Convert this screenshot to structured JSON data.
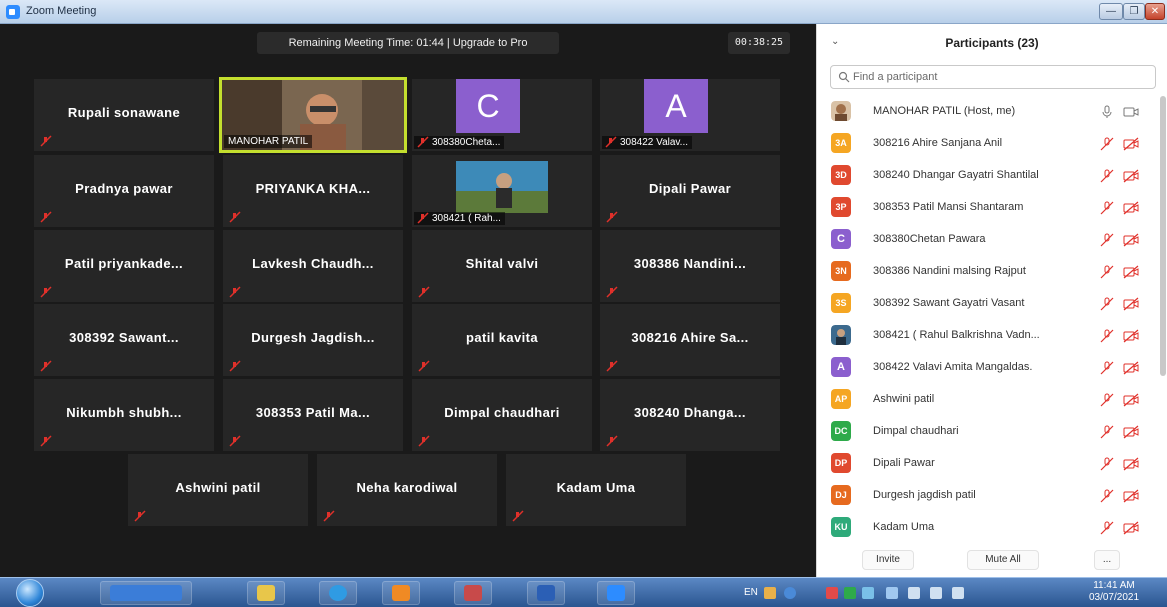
{
  "window": {
    "title": "Zoom Meeting"
  },
  "meeting": {
    "banner": "Remaining Meeting Time: 01:44 | Upgrade to Pro",
    "elapsed": "00:38:25",
    "tiles": [
      {
        "name": "Rupali sonawane"
      },
      {
        "name": "MANOHAR PATIL"
      },
      {
        "name": "308380Cheta...",
        "letter": "C"
      },
      {
        "name": "308422 Valav...",
        "letter": "A"
      },
      {
        "name": "Pradnya pawar"
      },
      {
        "name": "PRIYANKA KHA..."
      },
      {
        "name": "308421 ( Rah..."
      },
      {
        "name": "Dipali Pawar"
      },
      {
        "name": "Patil priyankade..."
      },
      {
        "name": "Lavkesh Chaudh..."
      },
      {
        "name": "Shital valvi"
      },
      {
        "name": "308386 Nandini..."
      },
      {
        "name": "308392 Sawant..."
      },
      {
        "name": "Durgesh Jagdish..."
      },
      {
        "name": "patil kavita"
      },
      {
        "name": "308216 Ahire Sa..."
      },
      {
        "name": "Nikumbh shubh..."
      },
      {
        "name": "308353 Patil Ma..."
      },
      {
        "name": "Dimpal chaudhari"
      },
      {
        "name": "308240 Dhanga..."
      },
      {
        "name": "Ashwini patil"
      },
      {
        "name": "Neha karodiwal"
      },
      {
        "name": "Kadam Uma"
      }
    ]
  },
  "participants": {
    "title": "Participants (23)",
    "search_placeholder": "Find a participant",
    "list": [
      {
        "name": "MANOHAR PATIL (Host, me)",
        "initials": "",
        "color": "#b07a4a"
      },
      {
        "name": "308216 Ahire Sanjana Anil",
        "initials": "3A",
        "color": "#f5a623"
      },
      {
        "name": "308240 Dhangar Gayatri Shantilal",
        "initials": "3D",
        "color": "#e0492f"
      },
      {
        "name": "308353 Patil Mansi Shantaram",
        "initials": "3P",
        "color": "#e0492f"
      },
      {
        "name": "308380Chetan Pawara",
        "initials": "C",
        "color": "#8b5fce"
      },
      {
        "name": "308386 Nandini malsing Rajput",
        "initials": "3N",
        "color": "#e66a1f"
      },
      {
        "name": "308392 Sawant Gayatri Vasant",
        "initials": "3S",
        "color": "#f5a623"
      },
      {
        "name": "308421 ( Rahul Balkrishna Vadn...",
        "initials": "",
        "color": "#3c6a8e"
      },
      {
        "name": "308422 Valavi Amita Mangaldas.",
        "initials": "A",
        "color": "#8b5fce"
      },
      {
        "name": "Ashwini patil",
        "initials": "AP",
        "color": "#f5a623"
      },
      {
        "name": "Dimpal chaudhari",
        "initials": "DC",
        "color": "#2eaa4a"
      },
      {
        "name": "Dipali Pawar",
        "initials": "DP",
        "color": "#e0492f"
      },
      {
        "name": "Durgesh jagdish patil",
        "initials": "DJ",
        "color": "#e66a1f"
      },
      {
        "name": "Kadam Uma",
        "initials": "KU",
        "color": "#2eaa7a"
      }
    ],
    "footer": {
      "invite": "Invite",
      "mute_all": "Mute All",
      "more": "..."
    }
  },
  "taskbar": {
    "lang": "EN",
    "time": "11:41 AM",
    "date": "03/07/2021"
  },
  "colors": {
    "accent": "#2d8cff",
    "active_speaker": "#c4df2e",
    "muted_red": "#e0302a"
  }
}
